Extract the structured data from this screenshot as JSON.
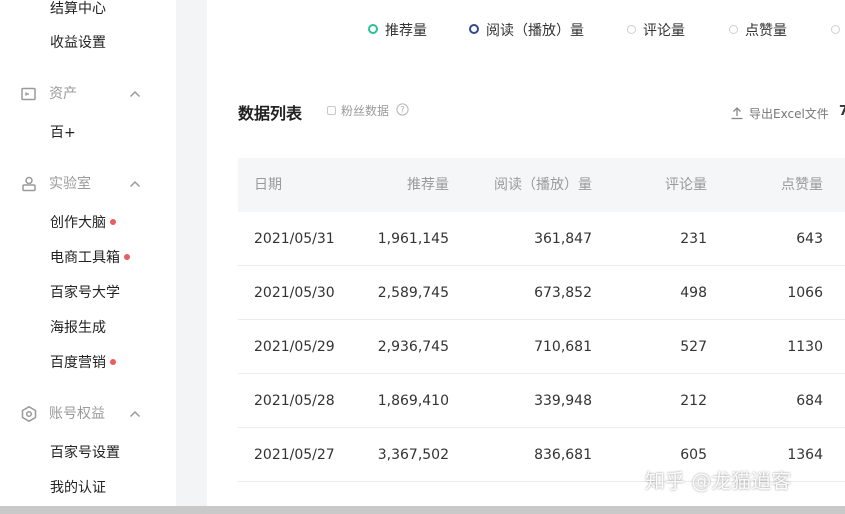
{
  "colors": {
    "dot_red": "#e85d5d",
    "ring_green": "#2bbf9a",
    "ring_blue": "#2f4b8c",
    "ring_off": "#cfcfcf"
  },
  "sidebar": {
    "top_items": [
      {
        "label": "结算中心"
      },
      {
        "label": "收益设置"
      }
    ],
    "sections": [
      {
        "label": "资产",
        "icon": "wallet-icon",
        "items": [
          {
            "label": "百+",
            "dot": false
          }
        ]
      },
      {
        "label": "实验室",
        "icon": "user-badge-icon",
        "items": [
          {
            "label": "创作大脑",
            "dot": true
          },
          {
            "label": "电商工具箱",
            "dot": true
          },
          {
            "label": "百家号大学",
            "dot": false
          },
          {
            "label": "海报生成",
            "dot": false
          },
          {
            "label": "百度营销",
            "dot": true
          }
        ]
      },
      {
        "label": "账号权益",
        "icon": "hexagon-icon",
        "items": [
          {
            "label": "百家号设置",
            "dot": false
          },
          {
            "label": "我的认证",
            "dot": false
          }
        ]
      }
    ]
  },
  "legend": [
    {
      "label": "推荐量",
      "state": "on",
      "color": "#2bbf9a"
    },
    {
      "label": "阅读（播放）量",
      "state": "on",
      "color": "#2f4b8c"
    },
    {
      "label": "评论量",
      "state": "off",
      "color": "#cfcfcf"
    },
    {
      "label": "点赞量",
      "state": "off",
      "color": "#cfcfcf"
    }
  ],
  "toolbar": {
    "title": "数据列表",
    "fans_label": "粉丝数据",
    "export_label": "导出Excel文件",
    "edge_glyph": "7"
  },
  "table": {
    "headers": {
      "date": "日期",
      "rec": "推荐量",
      "read": "阅读（播放）量",
      "comments": "评论量",
      "likes": "点赞量"
    },
    "rows": [
      {
        "date": "2021/05/31",
        "rec": "1,961,145",
        "read": "361,847",
        "comments": "231",
        "likes": "643"
      },
      {
        "date": "2021/05/30",
        "rec": "2,589,745",
        "read": "673,852",
        "comments": "498",
        "likes": "1066"
      },
      {
        "date": "2021/05/29",
        "rec": "2,936,745",
        "read": "710,681",
        "comments": "527",
        "likes": "1130"
      },
      {
        "date": "2021/05/28",
        "rec": "1,869,410",
        "read": "339,948",
        "comments": "212",
        "likes": "684"
      },
      {
        "date": "2021/05/27",
        "rec": "3,367,502",
        "read": "836,681",
        "comments": "605",
        "likes": "1364"
      }
    ]
  },
  "watermark": "知乎 @龙猫逍客"
}
